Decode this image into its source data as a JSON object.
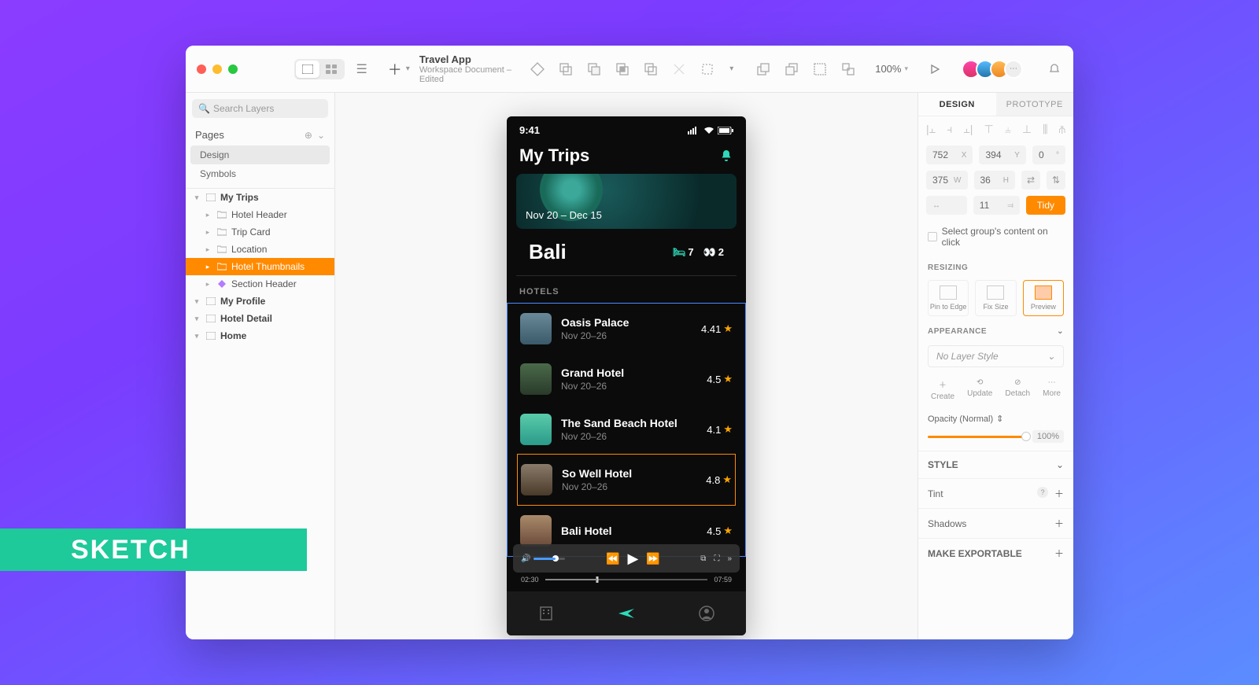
{
  "badge": "SKETCH",
  "titlebar": {
    "doc_title": "Travel App",
    "doc_subtitle": "Workspace Document – Edited",
    "zoom": "100%"
  },
  "left": {
    "search_placeholder": "Search Layers",
    "pages_label": "Pages",
    "pages": [
      "Design",
      "Symbols"
    ],
    "layers": [
      {
        "name": "My Trips",
        "depth": 1,
        "icon": "artboard"
      },
      {
        "name": "Hotel Header",
        "depth": 2,
        "icon": "group"
      },
      {
        "name": "Trip Card",
        "depth": 2,
        "icon": "group"
      },
      {
        "name": "Location",
        "depth": 2,
        "icon": "group"
      },
      {
        "name": "Hotel Thumbnails",
        "depth": 2,
        "icon": "group",
        "selected": true
      },
      {
        "name": "Section Header",
        "depth": 2,
        "icon": "symbol"
      },
      {
        "name": "My Profile",
        "depth": 1,
        "icon": "artboard"
      },
      {
        "name": "Hotel Detail",
        "depth": 1,
        "icon": "artboard"
      },
      {
        "name": "Home",
        "depth": 1,
        "icon": "artboard"
      }
    ]
  },
  "artboard": {
    "time": "9:41",
    "title": "My Trips",
    "hero_dates": "Nov 20 – Dec 15",
    "location": "Bali",
    "beds": "7",
    "binoc": "2",
    "section": "HOTELS",
    "hotels": [
      {
        "name": "Oasis Palace",
        "dates": "Nov 20–26",
        "rating": "4.41"
      },
      {
        "name": "Grand Hotel",
        "dates": "Nov 20–26",
        "rating": "4.5"
      },
      {
        "name": "The Sand Beach Hotel",
        "dates": "Nov 20–26",
        "rating": "4.1"
      },
      {
        "name": "So Well Hotel",
        "dates": "Nov 20–26",
        "rating": "4.8"
      },
      {
        "name": "Bali Hotel",
        "dates": "",
        "rating": "4.5"
      }
    ],
    "video": {
      "cur": "02:30",
      "total": "07:59"
    }
  },
  "inspector": {
    "tabs": [
      "DESIGN",
      "PROTOTYPE"
    ],
    "x": "752",
    "y": "394",
    "w": "375",
    "h": "36",
    "gap": "11",
    "tidy": "Tidy",
    "select_group": "Select group's content on click",
    "resizing_label": "RESIZING",
    "resize_opts": [
      "Pin to Edge",
      "Fix Size",
      "Preview"
    ],
    "appearance_label": "APPEARANCE",
    "layer_style": "No Layer Style",
    "style_actions": [
      "Create",
      "Update",
      "Detach",
      "More"
    ],
    "opacity_label": "Opacity (Normal)",
    "opacity_val": "100%",
    "style_section": "STYLE",
    "tint": "Tint",
    "shadows": "Shadows",
    "exportable": "MAKE EXPORTABLE"
  }
}
